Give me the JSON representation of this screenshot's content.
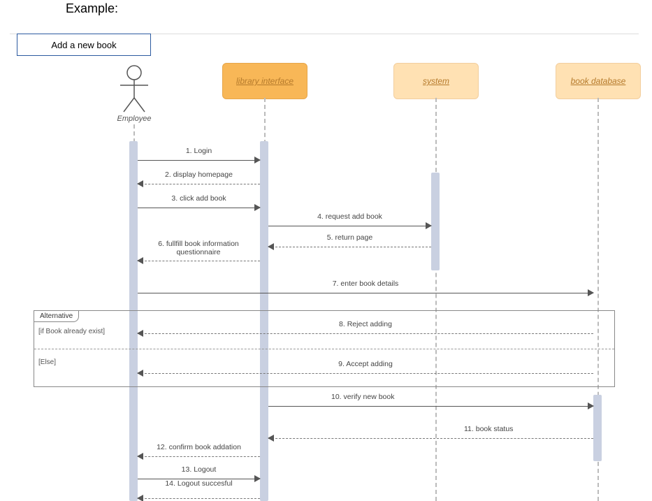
{
  "heading": "Example:",
  "title_box": "Add a new book",
  "actor": {
    "name": "Employee"
  },
  "participants": {
    "library": "library interface",
    "system": "system",
    "database": "book database"
  },
  "messages": {
    "m1": "1. Login",
    "m2": "2. display homepage",
    "m3": "3. click add book",
    "m4": "4. request add book",
    "m5": "5. return page",
    "m6": "6.  fullfill book information questionnaire",
    "m7": "7. enter book details",
    "m8": "8. Reject adding",
    "m9": "9. Accept adding",
    "m10": "10. verify new book",
    "m11": "11. book status",
    "m12": "12. confirm book addation",
    "m13": "13. Logout",
    "m14": "14.  Logout succesful"
  },
  "alt": {
    "label": "Alternative",
    "guard1": "[if Book already exist]",
    "guard2": "[Else]"
  },
  "chart_data": {
    "type": "sequence-diagram",
    "title": "Add a new book",
    "actors": [
      {
        "id": "emp",
        "name": "Employee",
        "kind": "actor"
      },
      {
        "id": "lib",
        "name": "library interface",
        "kind": "object"
      },
      {
        "id": "sys",
        "name": "system",
        "kind": "object"
      },
      {
        "id": "db",
        "name": "book database",
        "kind": "object"
      }
    ],
    "messages": [
      {
        "n": 1,
        "from": "emp",
        "to": "lib",
        "label": "Login",
        "style": "sync"
      },
      {
        "n": 2,
        "from": "lib",
        "to": "emp",
        "label": "display homepage",
        "style": "return"
      },
      {
        "n": 3,
        "from": "emp",
        "to": "lib",
        "label": "click add book",
        "style": "sync"
      },
      {
        "n": 4,
        "from": "lib",
        "to": "sys",
        "label": "request add book",
        "style": "sync"
      },
      {
        "n": 5,
        "from": "sys",
        "to": "lib",
        "label": "return page",
        "style": "return"
      },
      {
        "n": 6,
        "from": "lib",
        "to": "emp",
        "label": "fullfill book information questionnaire",
        "style": "return"
      },
      {
        "n": 7,
        "from": "emp",
        "to": "db",
        "label": "enter book details",
        "style": "sync"
      },
      {
        "n": 8,
        "from": "db",
        "to": "emp",
        "label": "Reject adding",
        "style": "return",
        "fragment": "alt",
        "guard": "if Book already exist"
      },
      {
        "n": 9,
        "from": "db",
        "to": "emp",
        "label": "Accept adding",
        "style": "return",
        "fragment": "alt",
        "guard": "Else"
      },
      {
        "n": 10,
        "from": "lib",
        "to": "db",
        "label": "verify new book",
        "style": "sync"
      },
      {
        "n": 11,
        "from": "db",
        "to": "lib",
        "label": "book status",
        "style": "return"
      },
      {
        "n": 12,
        "from": "lib",
        "to": "emp",
        "label": "confirm book addation",
        "style": "return"
      },
      {
        "n": 13,
        "from": "emp",
        "to": "lib",
        "label": "Logout",
        "style": "sync"
      },
      {
        "n": 14,
        "from": "lib",
        "to": "emp",
        "label": "Logout succesful",
        "style": "return"
      }
    ],
    "fragments": [
      {
        "type": "alt",
        "label": "Alternative",
        "operands": [
          {
            "guard": "if Book already exist",
            "messages": [
              8
            ]
          },
          {
            "guard": "Else",
            "messages": [
              9
            ]
          }
        ]
      }
    ]
  }
}
